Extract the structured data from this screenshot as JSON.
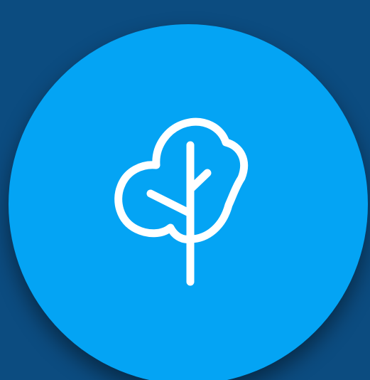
{
  "colors": {
    "background": "#0C4C80",
    "circle": "#04A4F4",
    "icon": "#FFFFFF"
  },
  "icon": {
    "name": "tree-icon"
  }
}
